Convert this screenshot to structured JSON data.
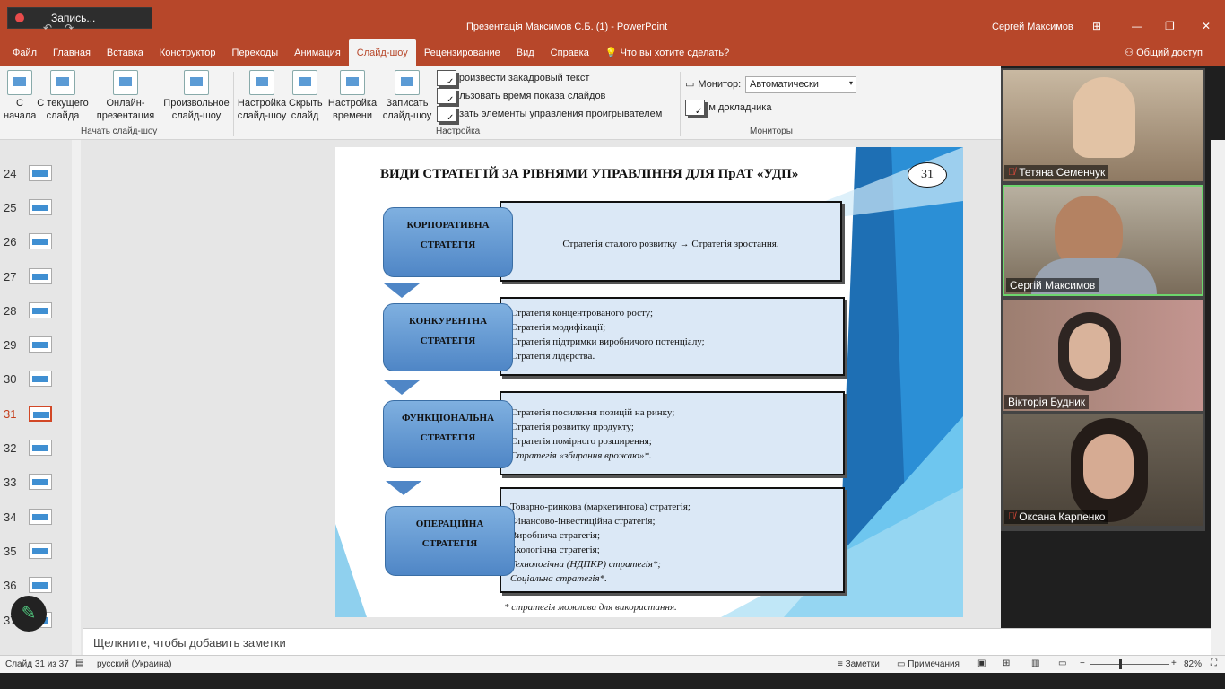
{
  "recording": {
    "label": "Запись..."
  },
  "window": {
    "title": "Презентація Максимов С.Б. (1)  -  PowerPoint",
    "user": "Сергей Максимов",
    "minimize": "—",
    "restore": "❐",
    "close": "✕",
    "ribbon_opt": "⊞"
  },
  "tabs": [
    {
      "label": "Файл"
    },
    {
      "label": "Главная"
    },
    {
      "label": "Вставка"
    },
    {
      "label": "Конструктор"
    },
    {
      "label": "Переходы"
    },
    {
      "label": "Анимация"
    },
    {
      "label": "Слайд-шоу"
    },
    {
      "label": "Рецензирование"
    },
    {
      "label": "Вид"
    },
    {
      "label": "Справка"
    },
    {
      "label": "Что вы хотите сделать?"
    }
  ],
  "share": "Общий доступ",
  "ribbon": {
    "from_start": "С\nначала",
    "from_current": "С текущего\nслайда",
    "online": "Онлайн-\nпрезентация",
    "custom": "Произвольное\nслайд-шоу",
    "group_start": "Начать слайд-шоу",
    "setup": "Настройка\nслайд-шоу",
    "hide": "Скрыть\nслайд",
    "rehearse": "Настройка\nвремени",
    "record": "Записать\nслайд-шоу",
    "chk1": "Воспроизвести закадровый текст",
    "chk2": "Использовать время показа слайдов",
    "chk3": "Показать элементы управления проигрывателем",
    "group_setup": "Настройка",
    "monitor_label": "Монитор:",
    "monitor_value": "Автоматически",
    "presenter": "Режим докладчика",
    "group_monitors": "Мониторы"
  },
  "thumbs": [
    {
      "n": "24"
    },
    {
      "n": "25"
    },
    {
      "n": "26"
    },
    {
      "n": "27"
    },
    {
      "n": "28"
    },
    {
      "n": "29"
    },
    {
      "n": "30"
    },
    {
      "n": "31"
    },
    {
      "n": "32"
    },
    {
      "n": "33"
    },
    {
      "n": "34"
    },
    {
      "n": "35"
    },
    {
      "n": "36"
    },
    {
      "n": "37"
    }
  ],
  "slide": {
    "title": "ВИДИ СТРАТЕГІЙ ЗА РІВНЯМИ УПРАВЛІННЯ ДЛЯ ПрАТ «УДП»",
    "number": "31",
    "levels": [
      {
        "name1": "КОРПОРАТИВНА",
        "name2": "СТРАТЕГІЯ",
        "lines": [
          "Стратегія сталого розвитку → Стратегія зростання."
        ]
      },
      {
        "name1": "КОНКУРЕНТНА",
        "name2": "СТРАТЕГІЯ",
        "lines": [
          "Стратегія концентрованого росту;",
          "Стратегія модифікації;",
          "Стратегія підтримки виробничого потенціалу;",
          "Стратегія лідерства."
        ]
      },
      {
        "name1": "ФУНКЦІОНАЛЬНА",
        "name2": "СТРАТЕГІЯ",
        "lines": [
          "Стратегія посилення позицій на ринку;",
          "Стратегія розвитку продукту;",
          "Стратегія помірного розширення;",
          "Стратегія «збирання врожаю»*."
        ]
      },
      {
        "name1": "ОПЕРАЦІЙНА",
        "name2": "СТРАТЕГІЯ",
        "lines": [
          "Товарно-ринкова (маркетингова) стратегія;",
          "Фінансово-інвестиційна стратегія;",
          "Виробнича стратегія;",
          "Екологічна стратегія;",
          "Технологічна (НДПКР) стратегія*;",
          "Соціальна стратегія*."
        ]
      }
    ],
    "footnote": "* стратегія можлива для використання."
  },
  "notes_placeholder": "Щелкните, чтобы добавить заметки",
  "status": {
    "slide": "Слайд 31 из 37",
    "lang": "русский (Украина)",
    "notes": "Заметки",
    "comments": "Примечания",
    "zoom": "82%",
    "minus": "−",
    "plus": "+"
  },
  "participants": [
    {
      "name": "Тетяна Семенчук",
      "muted": true
    },
    {
      "name": "Сергій Максимов",
      "muted": false
    },
    {
      "name": "Вікторія Будник",
      "muted": false
    },
    {
      "name": "Оксана Карпенко",
      "muted": true
    }
  ],
  "colors": {
    "accent": "#b7472a",
    "speaker": "#6dd66d"
  }
}
